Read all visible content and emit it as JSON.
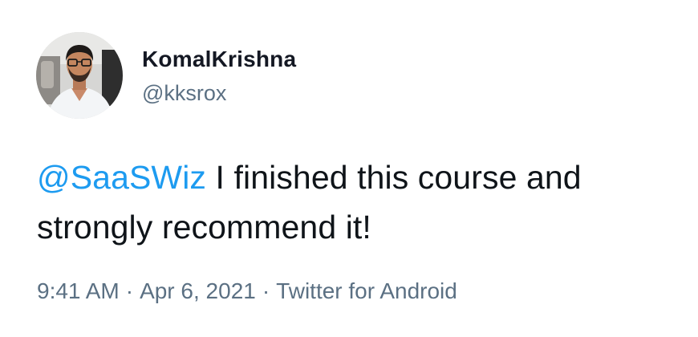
{
  "user": {
    "display_name": "KomalKrishna",
    "handle": "@kksrox"
  },
  "tweet": {
    "mention": "@SaaSWiz",
    "text_after_mention": " I finished this course and strongly recommend it!"
  },
  "meta": {
    "time": "9:41 AM",
    "separator": "·",
    "date": "Apr 6, 2021",
    "source": "Twitter for Android"
  },
  "colors": {
    "mention": "#1d9bf0",
    "secondary_text": "#5b7083",
    "primary_text": "#0f1419",
    "background": "#ffffff"
  }
}
